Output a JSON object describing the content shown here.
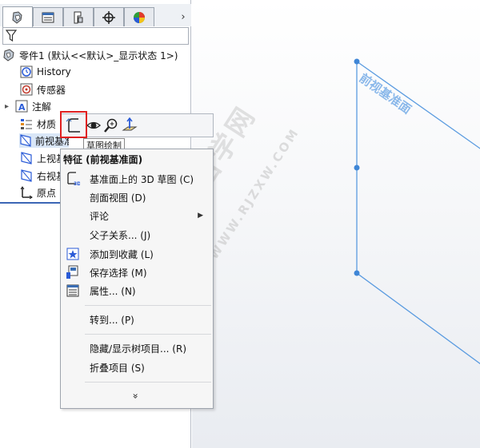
{
  "tree": {
    "root": "零件1  (默认<<默认>_显示状态 1>)",
    "items": [
      {
        "label": "History"
      },
      {
        "label": "传感器"
      },
      {
        "label": "注解"
      },
      {
        "label": "材质"
      },
      {
        "label": "前视基准面"
      },
      {
        "label": "上视基"
      },
      {
        "label": "右视基"
      },
      {
        "label": "原点"
      }
    ]
  },
  "toolbar": {
    "tooltip": "草图绘制"
  },
  "menu": {
    "title": "特征 (前视基准面)",
    "items": [
      {
        "label": "基准面上的 3D 草图 (C)"
      },
      {
        "label": "剖面视图 (D)"
      },
      {
        "label": "评论"
      },
      {
        "label": "父子关系... (J)"
      },
      {
        "label": "添加到收藏 (L)"
      },
      {
        "label": "保存选择 (M)"
      },
      {
        "label": "属性... (N)"
      },
      {
        "label": "转到... (P)"
      },
      {
        "label": "隐藏/显示树项目... (R)"
      },
      {
        "label": "折叠项目 (S)"
      }
    ],
    "expand": "»"
  },
  "viewport": {
    "plane_label": "前视基准面"
  },
  "watermark": {
    "main": "软件自学网",
    "sub": "WWW.RJZXW.COM"
  },
  "colors": {
    "plane": "#4a90d9",
    "highlight": "#e02020",
    "selection": "#d9e6f7"
  }
}
